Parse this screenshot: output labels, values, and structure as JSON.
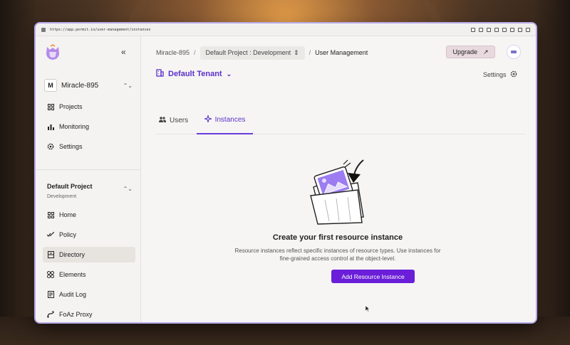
{
  "browser": {
    "url": "https://app.permit.io/user-management/instances"
  },
  "sidebar": {
    "collapse_icon": "«",
    "org": {
      "initial": "M",
      "name": "Miracle-895"
    },
    "top_items": [
      {
        "label": "Projects",
        "icon": "grid-icon"
      },
      {
        "label": "Monitoring",
        "icon": "bar-chart-icon"
      },
      {
        "label": "Settings",
        "icon": "gear-icon"
      }
    ],
    "project": {
      "name": "Default Project",
      "env": "Development"
    },
    "project_items": [
      {
        "label": "Home",
        "icon": "home-icon"
      },
      {
        "label": "Policy",
        "icon": "policy-icon"
      },
      {
        "label": "Directory",
        "icon": "directory-icon",
        "active": true
      },
      {
        "label": "Elements",
        "icon": "elements-icon"
      },
      {
        "label": "Audit Log",
        "icon": "audit-log-icon"
      },
      {
        "label": "FoAz Proxy",
        "icon": "proxy-icon"
      }
    ]
  },
  "header": {
    "breadcrumb": {
      "org": "Miracle-895",
      "project_env": "Default Project : Development",
      "current": "User Management"
    },
    "upgrade_label": "Upgrade",
    "tenant_label": "Default Tenant",
    "settings_label": "Settings"
  },
  "tabs": [
    {
      "label": "Users",
      "active": false
    },
    {
      "label": "Instances",
      "active": true
    }
  ],
  "empty_state": {
    "title": "Create your first resource instance",
    "description": "Resource instances reflect specific instances of resource types. Use instances for fine-grained access control at the object-level.",
    "button_label": "Add Resource Instance"
  },
  "colors": {
    "accent": "#6a1ed8",
    "tenant_purple": "#5b30c9"
  }
}
